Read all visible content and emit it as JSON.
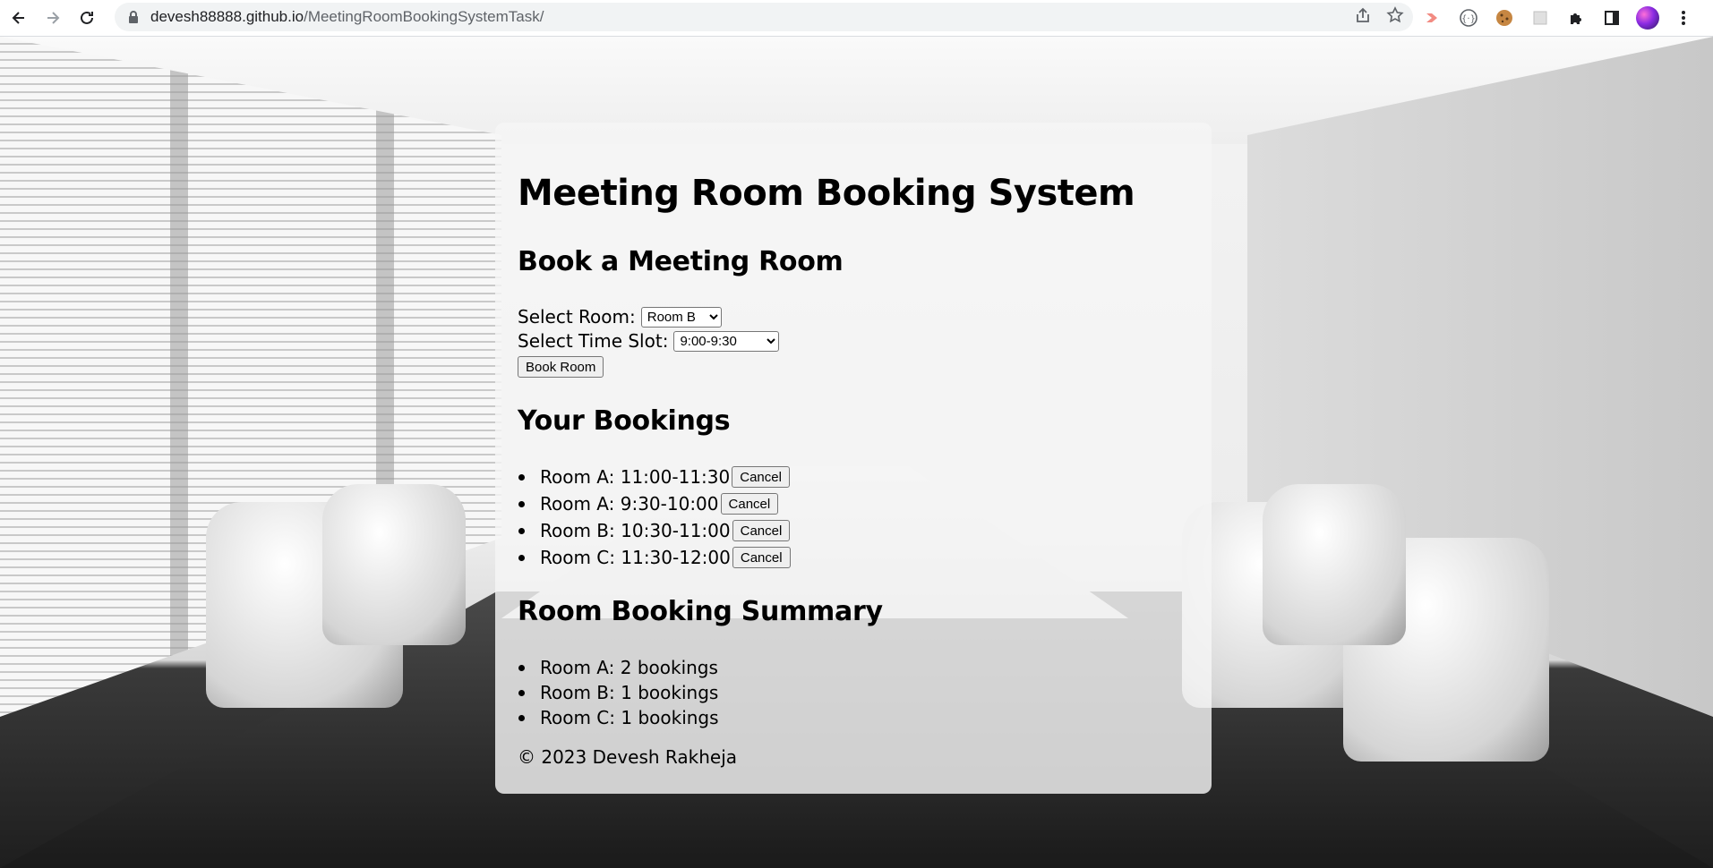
{
  "browser": {
    "url_host": "devesh88888.github.io",
    "url_path": "/MeetingRoomBookingSystemTask/"
  },
  "app": {
    "title": "Meeting Room Booking System",
    "book_heading": "Book a Meeting Room",
    "select_room_label": "Select Room:",
    "selected_room": "Room B",
    "select_slot_label": "Select Time Slot:",
    "selected_slot": "9:00-9:30",
    "book_button": "Book Room",
    "bookings_heading": "Your Bookings",
    "bookings": [
      {
        "text": "Room A: 11:00-11:30",
        "cancel": "Cancel"
      },
      {
        "text": "Room A: 9:30-10:00",
        "cancel": "Cancel"
      },
      {
        "text": "Room B: 10:30-11:00",
        "cancel": "Cancel"
      },
      {
        "text": "Room C: 11:30-12:00",
        "cancel": "Cancel"
      }
    ],
    "summary_heading": "Room Booking Summary",
    "summary": [
      "Room A: 2 bookings",
      "Room B: 1 bookings",
      "Room C: 1 bookings"
    ],
    "footer": "© 2023 Devesh Rakheja"
  }
}
